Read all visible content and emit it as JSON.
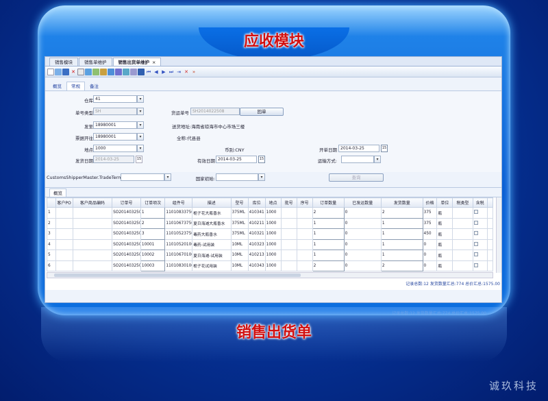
{
  "titles": {
    "top": "应收模块",
    "bottom": "销售出货单",
    "watermark": "诚玖科技"
  },
  "doc_tabs": [
    {
      "label": "销售模块"
    },
    {
      "label": "销售单维护"
    },
    {
      "label": "销售出货单维护",
      "close": "×"
    }
  ],
  "sub_tabs": [
    "概览",
    "常规",
    "备注"
  ],
  "form": {
    "warehouse": {
      "label": "仓库",
      "value": "41"
    },
    "doc_type": {
      "label": "单号类型",
      "value": "SH"
    },
    "delivery_no": {
      "label": "货运单号",
      "value": "SH2014022508"
    },
    "rollback_btn": "回单",
    "ship_to": {
      "label": "发至",
      "value": "18980001"
    },
    "ship_address": "送货地址:海南省琼海市中心市场三楼",
    "bill_to": {
      "label": "票据开往",
      "value": "18980001"
    },
    "full_name": "全称:代县县",
    "location": {
      "label": "地点",
      "value": "1000"
    },
    "currency": "币别:CNY",
    "open_date": {
      "label": "开单日期",
      "value": "2014-03-25"
    },
    "ship_date": {
      "label": "发货日期",
      "value": "2014-03-25"
    },
    "valid_date": {
      "label": "有效日期",
      "value": "2014-03-25"
    },
    "transport": {
      "label": "运输方式:",
      "value": ""
    },
    "trade_terms": {
      "label": "CustomsShipperMaster.TradeTerms:",
      "value": ""
    },
    "origin": {
      "label": "国家初始:",
      "value": ""
    },
    "query_btn": "查询"
  },
  "grid": {
    "tab": "概览",
    "columns": [
      "",
      "客户PO",
      "客户商品编码",
      "订单号",
      "订单项次",
      "组件号",
      "描述",
      "型号",
      "库位",
      "地点",
      "批号",
      "序号",
      "订单数量",
      "已发运数量",
      "发货数量",
      "价格",
      "单位",
      "税类型",
      "含税",
      ""
    ],
    "rows": [
      [
        "1",
        "",
        "",
        "SO2014032507",
        "1",
        "110108337500",
        "栀子花大瓶香水",
        "375ML",
        "410341",
        "1000",
        "",
        "",
        "2",
        "0",
        "2",
        "375",
        "瓶",
        "",
        ""
      ],
      [
        "2",
        "",
        "",
        "SO2014032507",
        "2",
        "110106737500",
        "夏日海滩大瓶香水",
        "375ML",
        "410211",
        "1000",
        "",
        "",
        "1",
        "0",
        "1",
        "375",
        "瓶",
        "",
        ""
      ],
      [
        "3",
        "",
        "",
        "SO2014032507",
        "3",
        "110105237500",
        "毒药大瓶香水",
        "375ML",
        "410321",
        "1000",
        "",
        "",
        "1",
        "0",
        "1",
        "450",
        "瓶",
        "",
        ""
      ],
      [
        "4",
        "",
        "",
        "SO2014032507",
        "10001",
        "110105201000",
        "毒药-试用装",
        "10ML",
        "410323",
        "1000",
        "",
        "",
        "1",
        "0",
        "1",
        "0",
        "瓶",
        "",
        ""
      ],
      [
        "5",
        "",
        "",
        "SO2014032507",
        "10002",
        "110106701000",
        "夏日海滩-试用装",
        "10ML",
        "410213",
        "1000",
        "",
        "",
        "1",
        "0",
        "1",
        "0",
        "瓶",
        "",
        ""
      ],
      [
        "6",
        "",
        "",
        "SO2014032507",
        "10003",
        "110108301000",
        "栀子花试用装",
        "10ML",
        "410343",
        "1000",
        "",
        "",
        "2",
        "0",
        "2",
        "0",
        "瓶",
        "",
        ""
      ]
    ],
    "status": "记录总数:12 发货数量汇总:774 总价汇总:1575.00"
  },
  "reflection_text": "记录总数:12 发货数量汇总:774 总价汇总:1575.00"
}
